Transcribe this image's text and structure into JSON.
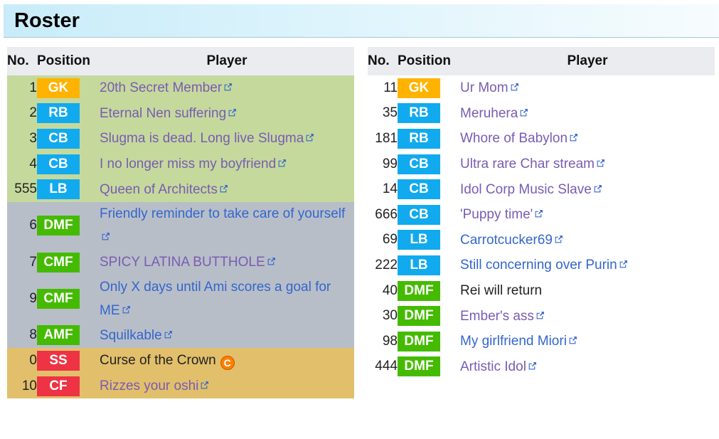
{
  "header": {
    "title": "Roster"
  },
  "columns": {
    "no": "No.",
    "position": "Position",
    "player": "Player"
  },
  "colors": {
    "GK": "#ffb300",
    "DEF": "#11aaee",
    "MID": "#44bb00",
    "FWD": "#ee3344",
    "group_def_bg": "#c5d99d",
    "group_mid_bg": "#b8bec8",
    "group_fwd_bg": "#e2bf6b",
    "link": "#3366cc",
    "visited_link": "#795cb2",
    "header_bg": "#eaecf0"
  },
  "left": [
    {
      "no": "1",
      "pos": "GK",
      "player": "20th Secret Member",
      "style": "visited",
      "ext": true
    },
    {
      "no": "2",
      "pos": "RB",
      "player": "Eternal Nen suffering",
      "style": "visited",
      "ext": true
    },
    {
      "no": "3",
      "pos": "CB",
      "player": "Slugma is dead. Long live Slugma",
      "style": "visited",
      "ext": true
    },
    {
      "no": "4",
      "pos": "CB",
      "player": "I no longer miss my boyfriend",
      "style": "visited",
      "ext": true
    },
    {
      "no": "555",
      "pos": "LB",
      "player": "Queen of Architects",
      "style": "visited",
      "ext": true
    },
    {
      "no": "6",
      "pos": "DMF",
      "player": "Friendly reminder to take care of yourself",
      "style": "link",
      "ext": true
    },
    {
      "no": "7",
      "pos": "CMF",
      "player": "SPICY LATINA BUTTHOLE",
      "style": "visited",
      "ext": true
    },
    {
      "no": "9",
      "pos": "CMF",
      "player": "Only X days until Ami scores a goal for ME",
      "style": "link",
      "ext": true
    },
    {
      "no": "8",
      "pos": "AMF",
      "player": "Squilkable",
      "style": "link",
      "ext": true
    },
    {
      "no": "0",
      "pos": "SS",
      "player": "Curse of the Crown",
      "style": "plain",
      "ext": false,
      "captain": "C"
    },
    {
      "no": "10",
      "pos": "CF",
      "player": "Rizzes your oshi",
      "style": "visited",
      "ext": true
    }
  ],
  "right": [
    {
      "no": "11",
      "pos": "GK",
      "player": "Ur Mom",
      "style": "visited",
      "ext": true
    },
    {
      "no": "35",
      "pos": "RB",
      "player": "Meruhera",
      "style": "visited",
      "ext": true
    },
    {
      "no": "181",
      "pos": "RB",
      "player": "Whore of Babylon",
      "style": "visited",
      "ext": true
    },
    {
      "no": "99",
      "pos": "CB",
      "player": "Ultra rare Char stream",
      "style": "visited",
      "ext": true
    },
    {
      "no": "14",
      "pos": "CB",
      "player": "Idol Corp Music Slave",
      "style": "visited",
      "ext": true
    },
    {
      "no": "666",
      "pos": "CB",
      "player": "'Puppy time'",
      "style": "visited",
      "ext": true
    },
    {
      "no": "69",
      "pos": "LB",
      "player": "Carrotcucker69",
      "style": "link",
      "ext": true
    },
    {
      "no": "222",
      "pos": "LB",
      "player": "Still concerning over Purin",
      "style": "link",
      "ext": true
    },
    {
      "no": "40",
      "pos": "DMF",
      "player": "Rei will return",
      "style": "plain",
      "ext": false
    },
    {
      "no": "30",
      "pos": "DMF",
      "player": "Ember's ass",
      "style": "visited",
      "ext": true
    },
    {
      "no": "98",
      "pos": "DMF",
      "player": "My girlfriend Miori",
      "style": "link",
      "ext": true
    },
    {
      "no": "444",
      "pos": "DMF",
      "player": "Artistic Idol",
      "style": "visited",
      "ext": true
    }
  ]
}
